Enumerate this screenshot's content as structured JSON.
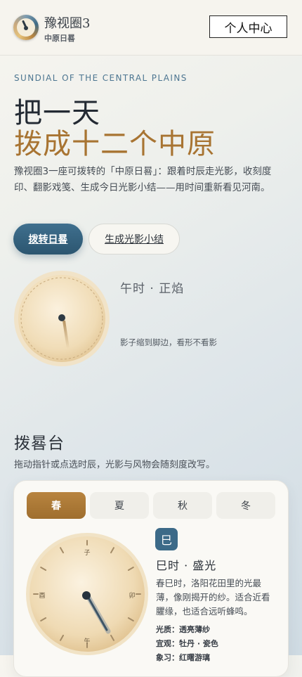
{
  "header": {
    "app_name": "豫视圈3",
    "app_subtitle": "中原日晷",
    "profile_button": "个人中心"
  },
  "hero": {
    "eyebrow": "SUNDIAL OF THE CENTRAL PLAINS",
    "title_line1": "把一天",
    "title_line2": "拨成十二个中原",
    "intro": "豫视圈3一座可拨转的「中原日晷」：跟着时辰走光影，收刻度印、翻影戏笺、生成今日光影小结——用时间重新看见河南。",
    "primary_button": "拨转日晷",
    "secondary_button": "生成光影小结",
    "current_hour": "午时  ·  正焰",
    "shadow_caption": "影子缩到脚边，看形不看影"
  },
  "dial_section": {
    "title": "拨晷台",
    "subtitle": "拖动指针或点选时辰，光影与风物会随刻度改写。",
    "seasons": [
      "春",
      "夏",
      "秋",
      "冬"
    ],
    "active_season": "春",
    "dial_marks": {
      "top": "子",
      "right": "卯",
      "bottom": "午",
      "left": "酉"
    },
    "selected": {
      "glyph": "巳",
      "title": "巳时  ·  盛光",
      "description": "春巳时，洛阳花田里的光最薄，像刚揭开的纱。适合近看臞缘，也适合远听蜂鸣。",
      "attributes": [
        "光质：透亮薄纱",
        "宜观：牡丹 · 瓷色",
        "象习：红曙游璃"
      ]
    }
  },
  "colors": {
    "accent_gold": "#a87432",
    "accent_blue": "#3c6a88",
    "background": "#e4eaec"
  }
}
